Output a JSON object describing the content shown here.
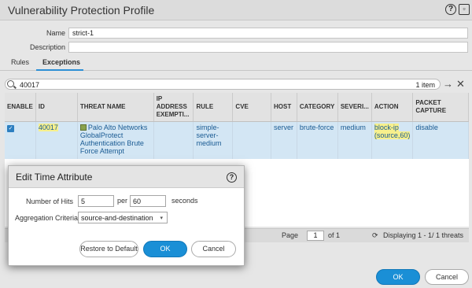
{
  "window": {
    "title": "Vulnerability Protection Profile"
  },
  "form": {
    "name_label": "Name",
    "name_value": "strict-1",
    "description_label": "Description",
    "description_value": ""
  },
  "tabs": [
    {
      "label": "Rules",
      "active": false
    },
    {
      "label": "Exceptions",
      "active": true
    }
  ],
  "search": {
    "query": "40017",
    "result_count": "1 item"
  },
  "table": {
    "columns": [
      "ENABLE",
      "ID",
      "THREAT NAME",
      "IP ADDRESS EXEMPTI...",
      "RULE",
      "CVE",
      "HOST",
      "CATEGORY",
      "SEVERI...",
      "ACTION",
      "PACKET CAPTURE"
    ],
    "rows": [
      {
        "enable": "✓",
        "id": "40017",
        "threat_name": "Palo Alto Networks GlobalProtect Authentication Brute Force Attempt",
        "ip_exemption": "",
        "rule": "simple-server-medium",
        "cve": "",
        "host": "server",
        "category": "brute-force",
        "severity": "medium",
        "action": "block-ip (source,60)",
        "packet_capture": "disable"
      }
    ]
  },
  "pager": {
    "page_label": "Page",
    "page_value": "1",
    "of_label": "of 1",
    "display_text": "Displaying 1 - 1/ 1 threats"
  },
  "footer": {
    "ok_label": "OK",
    "cancel_label": "Cancel"
  },
  "dialog": {
    "title": "Edit Time Attribute",
    "hits_label": "Number of Hits",
    "hits_value": "5",
    "per_label": "per",
    "per_value": "60",
    "seconds_label": "seconds",
    "aggregation_label": "Aggregation Criteria",
    "aggregation_value": "source-and-destination",
    "restore_label": "Restore to Default",
    "ok_label": "OK",
    "cancel_label": "Cancel"
  },
  "colors": {
    "accent": "#1a8fd6",
    "highlight": "#f7f08c",
    "row_selected": "#d3e6f4"
  }
}
